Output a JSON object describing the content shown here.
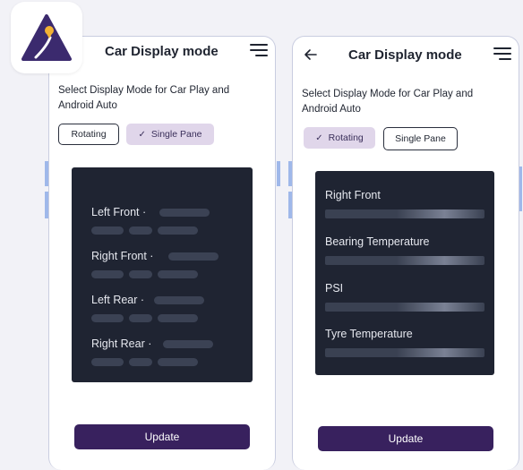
{
  "screen_a": {
    "title": "Car Display mode",
    "description": "Select Display Mode for Car Play and Android Auto",
    "modes": [
      {
        "label": "Rotating",
        "selected": false
      },
      {
        "label": "Single Pane",
        "selected": true
      }
    ],
    "tires": [
      {
        "label": "Left Front ·"
      },
      {
        "label": "Right Front ·"
      },
      {
        "label": "Left Rear ·"
      },
      {
        "label": "Right Rear ·"
      }
    ],
    "update_label": "Update"
  },
  "screen_b": {
    "title": "Car Display mode",
    "description": "Select Display Mode for Car Play and Android Auto",
    "modes": [
      {
        "label": "Rotating",
        "selected": true
      },
      {
        "label": "Single Pane",
        "selected": false
      }
    ],
    "readings": [
      {
        "label": "Right Front"
      },
      {
        "label": "Bearing Temperature"
      },
      {
        "label": "PSI"
      },
      {
        "label": "Tyre Temperature"
      }
    ],
    "update_label": "Update"
  },
  "colors": {
    "accent": "#38215e",
    "selected_chip": "#e0d6ea",
    "panel": "#1f2432",
    "logo_fill": "#3b2a6e",
    "logo_pin": "#f2b234"
  },
  "icons": {
    "logo": "app-logo-icon",
    "menu": "hamburger-menu-icon",
    "back": "back-arrow-icon",
    "check": "checkmark-icon"
  }
}
